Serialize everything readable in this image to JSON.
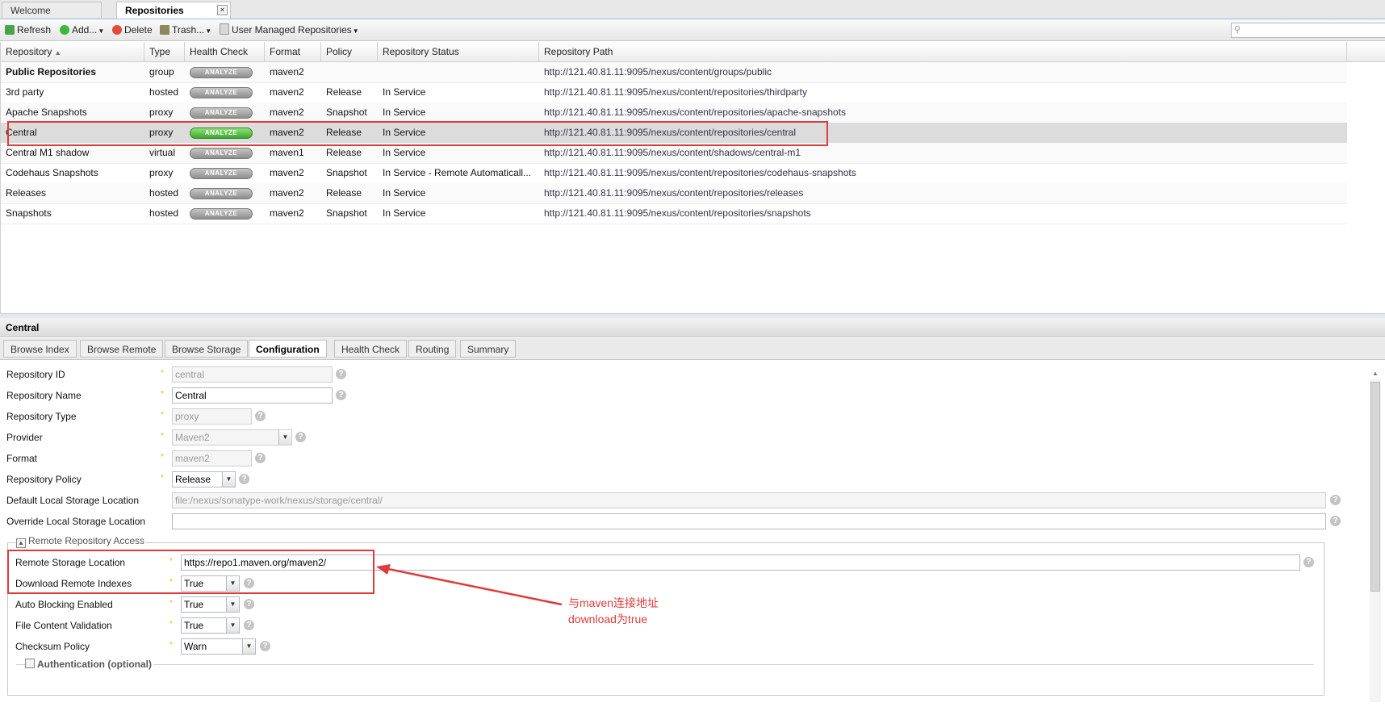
{
  "top_tabs": [
    {
      "label": "Welcome"
    },
    {
      "label": "Repositories",
      "close": "×"
    }
  ],
  "toolbar": {
    "refresh": "Refresh",
    "add": "Add...",
    "delete": "Delete",
    "trash": "Trash...",
    "user_managed": "User Managed Repositories"
  },
  "grid": {
    "headers": [
      "Repository",
      "Type",
      "Health Check",
      "Format",
      "Policy",
      "Repository Status",
      "Repository Path"
    ],
    "sort_indicator": "▲",
    "analyze_label": "ANALYZE",
    "rows": [
      {
        "name": "Public Repositories",
        "type": "group",
        "format": "maven2",
        "policy": "",
        "status": "",
        "path": "http://121.40.81.11:9095/nexus/content/groups/public"
      },
      {
        "name": "3rd party",
        "type": "hosted",
        "format": "maven2",
        "policy": "Release",
        "status": "In Service",
        "path": "http://121.40.81.11:9095/nexus/content/repositories/thirdparty"
      },
      {
        "name": "Apache Snapshots",
        "type": "proxy",
        "format": "maven2",
        "policy": "Snapshot",
        "status": "In Service",
        "path": "http://121.40.81.11:9095/nexus/content/repositories/apache-snapshots"
      },
      {
        "name": "Central",
        "type": "proxy",
        "format": "maven2",
        "policy": "Release",
        "status": "In Service",
        "path": "http://121.40.81.11:9095/nexus/content/repositories/central"
      },
      {
        "name": "Central M1 shadow",
        "type": "virtual",
        "format": "maven1",
        "policy": "Release",
        "status": "In Service",
        "path": "http://121.40.81.11:9095/nexus/content/shadows/central-m1"
      },
      {
        "name": "Codehaus Snapshots",
        "type": "proxy",
        "format": "maven2",
        "policy": "Snapshot",
        "status": "In Service - Remote Automaticall...",
        "path": "http://121.40.81.11:9095/nexus/content/repositories/codehaus-snapshots"
      },
      {
        "name": "Releases",
        "type": "hosted",
        "format": "maven2",
        "policy": "Release",
        "status": "In Service",
        "path": "http://121.40.81.11:9095/nexus/content/repositories/releases"
      },
      {
        "name": "Snapshots",
        "type": "hosted",
        "format": "maven2",
        "policy": "Snapshot",
        "status": "In Service",
        "path": "http://121.40.81.11:9095/nexus/content/repositories/snapshots"
      }
    ]
  },
  "detail": {
    "title": "Central",
    "tabs": [
      "Browse Index",
      "Browse Remote",
      "Browse Storage",
      "Configuration",
      "Health Check",
      "Routing",
      "Summary"
    ]
  },
  "form": {
    "repository_id": {
      "label": "Repository ID",
      "value": "central"
    },
    "repository_name": {
      "label": "Repository Name",
      "value": "Central"
    },
    "repository_type": {
      "label": "Repository Type",
      "value": "proxy"
    },
    "provider": {
      "label": "Provider",
      "value": "Maven2"
    },
    "format": {
      "label": "Format",
      "value": "maven2"
    },
    "repository_policy": {
      "label": "Repository Policy",
      "value": "Release"
    },
    "default_storage": {
      "label": "Default Local Storage Location",
      "value": "file:/nexus/sonatype-work/nexus/storage/central/"
    },
    "override_storage": {
      "label": "Override Local Storage Location",
      "value": ""
    },
    "remote_access_legend": "Remote Repository Access",
    "remote_storage": {
      "label": "Remote Storage Location",
      "value": "https://repo1.maven.org/maven2/"
    },
    "download_indexes": {
      "label": "Download Remote Indexes",
      "value": "True"
    },
    "auto_blocking": {
      "label": "Auto Blocking Enabled",
      "value": "True"
    },
    "file_validation": {
      "label": "File Content Validation",
      "value": "True"
    },
    "checksum_policy": {
      "label": "Checksum Policy",
      "value": "Warn"
    },
    "auth_legend": "Authentication (optional)",
    "required_mark": "*",
    "help_mark": "?",
    "dropdown_mark": "▼"
  },
  "annotation": {
    "line1": "与maven连接地址",
    "line2": "download为true",
    "color": "#e03a3a"
  }
}
